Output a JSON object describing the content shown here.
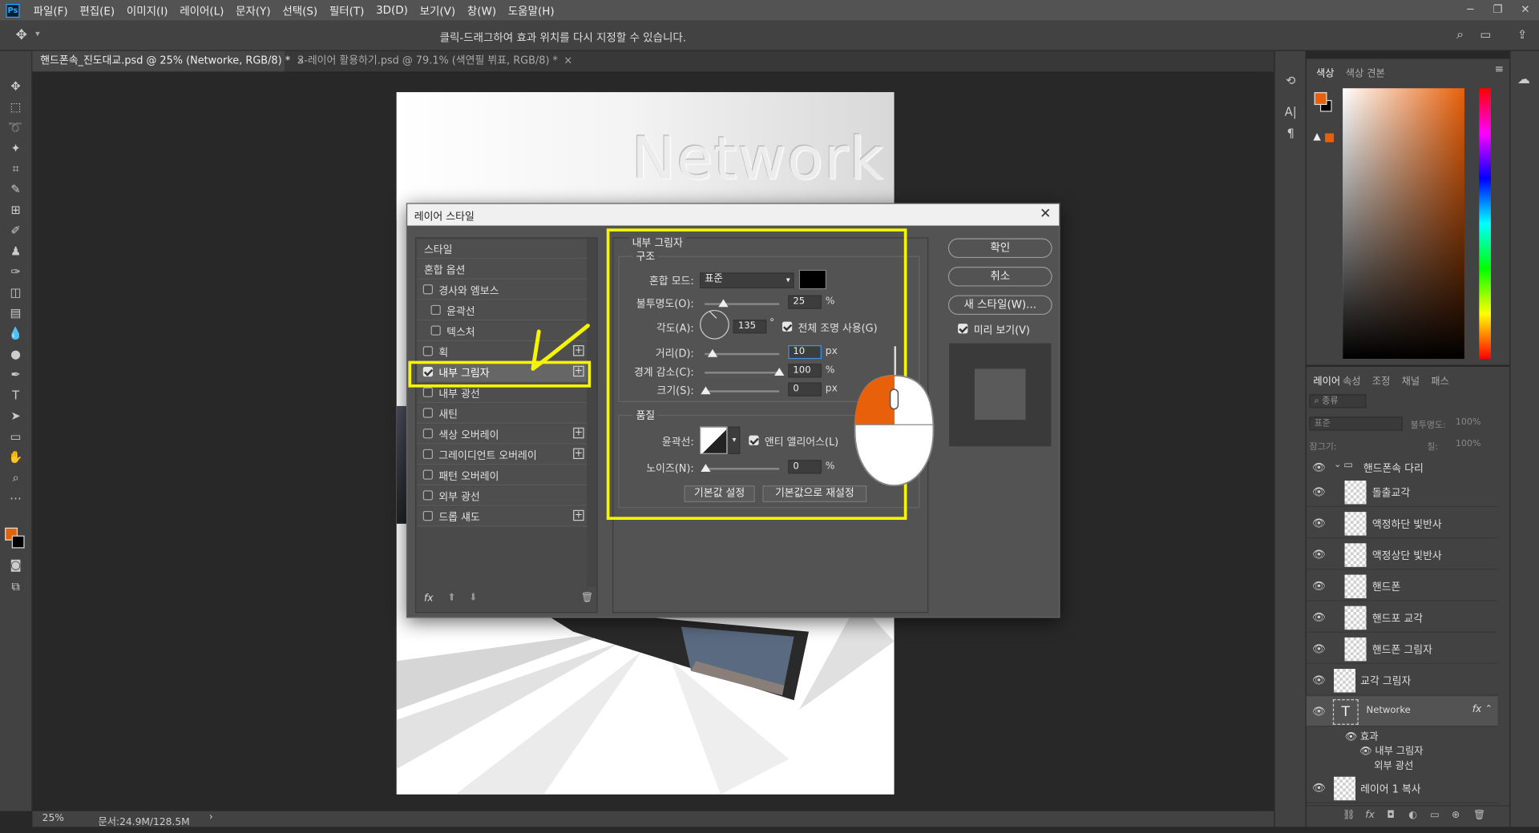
{
  "menubar": {
    "logo": "Ps",
    "items": [
      "파일(F)",
      "편집(E)",
      "이미지(I)",
      "레이어(L)",
      "문자(Y)",
      "선택(S)",
      "필터(T)",
      "3D(D)",
      "보기(V)",
      "창(W)",
      "도움말(H)"
    ]
  },
  "options": {
    "hint": "클릭-드래그하여 효과 위치를 다시 지정할 수 있습니다."
  },
  "tabs": [
    {
      "label": "핸드폰속_진도대교.psd @ 25% (Networke, RGB/8) *"
    },
    {
      "label": "3-레이어 활용하기.psd @ 79.1% (색연필 뷔표, RGB/8) *"
    }
  ],
  "canvas": {
    "title_text": "Network"
  },
  "status": {
    "zoom": "25%",
    "doc": "문서:24.9M/128.5M"
  },
  "colors": {
    "foreground": "#e8600a",
    "accent": "#f5f500"
  },
  "color_panel": {
    "tabs": [
      "색상",
      "색상 견본"
    ]
  },
  "layers_panel": {
    "tabs": [
      "레이어",
      "속성",
      "조정",
      "채널",
      "패스"
    ],
    "search_placeholder": "종류",
    "blend_mode": "표준",
    "opacity_label": "불투명도:",
    "opacity_value": "100%",
    "lock_label": "잠그기:",
    "fill_label": "칠:",
    "fill_value": "100%",
    "group_name": "핸드폰속 다리",
    "layers": [
      "돌출교각",
      "액정하단 빛반사",
      "액정상단 빛반사",
      "핸드폰",
      "핸드포 교각",
      "핸드폰 그림자",
      "교각 그림자",
      "Networke"
    ],
    "effects_label": "효과",
    "effects": [
      "내부 그림자",
      "외부 광선"
    ],
    "last_layer": "레이어 1 복사"
  },
  "dialog": {
    "title": "레이어 스타일",
    "styles_header": "스타일",
    "blend_options": "혼합 옵션",
    "style_items": [
      {
        "label": "경사와 엠보스",
        "checked": false
      },
      {
        "label": "윤곽선",
        "checked": false
      },
      {
        "label": "텍스처",
        "checked": false
      },
      {
        "label": "획",
        "checked": false
      },
      {
        "label": "내부 그림자",
        "checked": true
      },
      {
        "label": "내부 광선",
        "checked": false
      },
      {
        "label": "새틴",
        "checked": false
      },
      {
        "label": "색상 오버레이",
        "checked": false
      },
      {
        "label": "그레이디언트 오버레이",
        "checked": false
      },
      {
        "label": "패턴 오버레이",
        "checked": false
      },
      {
        "label": "외부 광선",
        "checked": false
      },
      {
        "label": "드롭 섀도",
        "checked": false
      }
    ],
    "section_title": "내부 그림자",
    "structure_title": "구조",
    "blend_mode_label": "혼합 모드:",
    "blend_mode_value": "표준",
    "shadow_color": "#000000",
    "opacity_label": "불투명도(O):",
    "opacity_value": "25",
    "angle_label": "각도(A):",
    "angle_value": "135",
    "global_light_label": "전체 조명 사용(G)",
    "distance_label": "거리(D):",
    "distance_value": "10",
    "choke_label": "경계 감소(C):",
    "choke_value": "100",
    "size_label": "크기(S):",
    "size_value": "0",
    "quality_title": "품질",
    "contour_label": "윤곽선:",
    "antialias_label": "앤티 앨리어스(L)",
    "noise_label": "노이즈(N):",
    "noise_value": "0",
    "percent": "%",
    "degree": "°",
    "px": "px",
    "make_default": "기본값 설정",
    "reset_default": "기본값으로 재설정",
    "ok": "확인",
    "cancel": "취소",
    "new_style": "새 스타일(W)...",
    "preview": "미리 보기(V)",
    "fx": "fx"
  }
}
